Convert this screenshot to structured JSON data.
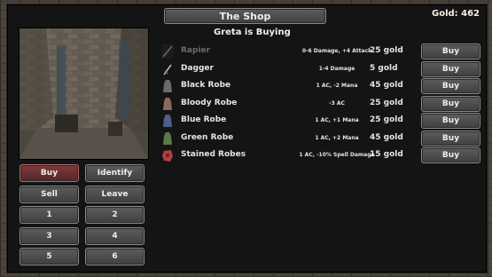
{
  "header": {
    "title": "The Shop",
    "gold_label": "Gold: 462"
  },
  "subtitle": "Greta is Buying",
  "items": [
    {
      "name": "Rapier",
      "stat": "0-6 Damage, +4 Attack",
      "price": "25 gold",
      "buy": "Buy",
      "dim": true,
      "icon": "sword-icon",
      "color": "#555"
    },
    {
      "name": "Dagger",
      "stat": "1-4 Damage",
      "price": "5 gold",
      "buy": "Buy",
      "dim": false,
      "icon": "dagger-icon",
      "color": "#999"
    },
    {
      "name": "Black Robe",
      "stat": "1 AC, -2 Mana",
      "price": "45 gold",
      "buy": "Buy",
      "dim": false,
      "icon": "robe-icon",
      "color": "#6b6b6b"
    },
    {
      "name": "Bloody Robe",
      "stat": "-3 AC",
      "price": "25 gold",
      "buy": "Buy",
      "dim": false,
      "icon": "robe-icon",
      "color": "#8a6a5a"
    },
    {
      "name": "Blue Robe",
      "stat": "1 AC, +1 Mana",
      "price": "25 gold",
      "buy": "Buy",
      "dim": false,
      "icon": "robe-icon",
      "color": "#4d5f8a"
    },
    {
      "name": "Green Robe",
      "stat": "1 AC, +2 Mana",
      "price": "45 gold",
      "buy": "Buy",
      "dim": false,
      "icon": "robe-icon",
      "color": "#5a7a4a"
    },
    {
      "name": "Stained Robes",
      "stat": "1 AC, -10% Spell Damage",
      "price": "15 gold",
      "buy": "Buy",
      "dim": false,
      "icon": "stained-robes-icon",
      "color": "#b04040"
    }
  ],
  "actions": {
    "buy": "Buy",
    "identify": "Identify",
    "sell": "Sell",
    "leave": "Leave",
    "n1": "1",
    "n2": "2",
    "n3": "3",
    "n4": "4",
    "n5": "5",
    "n6": "6"
  }
}
